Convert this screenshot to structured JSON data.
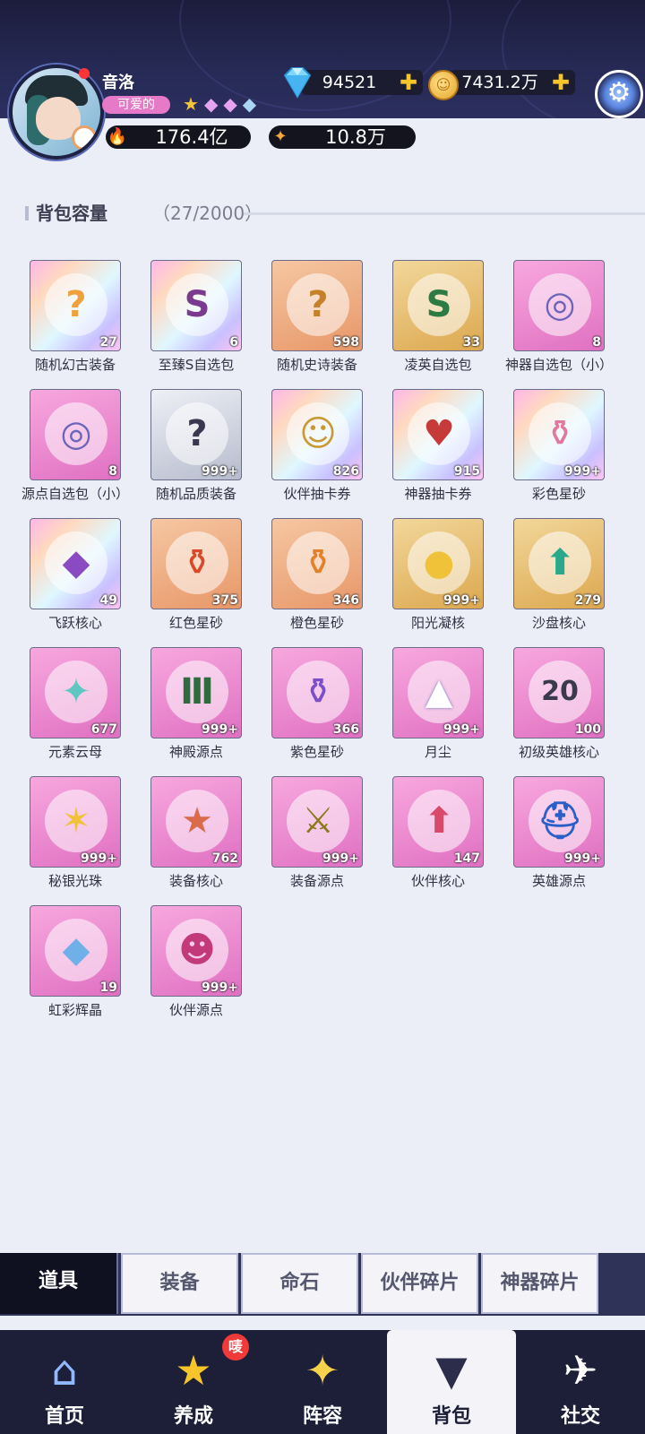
{
  "player": {
    "name": "音洛",
    "title_badge": "可爱的",
    "stars": [
      "★",
      "◆",
      "◆",
      "◆"
    ],
    "power": "176.4亿",
    "power_icon": "flame-icon",
    "stat2": "10.8万",
    "stat2_icon": "sparkle-icon"
  },
  "currency": {
    "diamonds": "94521",
    "gold": "7431.2万",
    "plus": "✚"
  },
  "capacity": {
    "label": "背包容量",
    "count": "（27/2000）"
  },
  "items": [
    {
      "name": "随机幻古装备",
      "qty": "27",
      "bg": "rainbow",
      "glyph": "?",
      "color": "#f0a03c",
      "icon": "chest-rainbow-icon"
    },
    {
      "name": "至臻S自选包",
      "qty": "6",
      "bg": "rainbow",
      "glyph": "S",
      "color": "#7a3b8f",
      "icon": "s-pack-icon"
    },
    {
      "name": "随机史诗装备",
      "qty": "598",
      "bg": "orange",
      "glyph": "?",
      "color": "#c5812a",
      "icon": "chest-epic-icon"
    },
    {
      "name": "凌英自选包",
      "qty": "33",
      "bg": "gold",
      "glyph": "S",
      "color": "#2d7a45",
      "icon": "s-pack-green-icon"
    },
    {
      "name": "神器自选包（小）",
      "qty": "8",
      "bg": "pink",
      "glyph": "◎",
      "color": "#6b64b8",
      "icon": "artifact-chest-icon"
    },
    {
      "name": "源点自选包（小）",
      "qty": "8",
      "bg": "pink",
      "glyph": "◎",
      "color": "#6b64b8",
      "icon": "source-chest-icon"
    },
    {
      "name": "随机品质装备",
      "qty": "999+",
      "bg": "silver",
      "glyph": "?",
      "color": "#3a3850",
      "icon": "mystery-chest-icon"
    },
    {
      "name": "伙伴抽卡券",
      "qty": "826",
      "bg": "rainbow",
      "glyph": "☺",
      "color": "#c99a33",
      "icon": "partner-card-icon"
    },
    {
      "name": "神器抽卡券",
      "qty": "915",
      "bg": "rainbow",
      "glyph": "♥",
      "color": "#c73a3a",
      "icon": "artifact-card-icon"
    },
    {
      "name": "彩色星砂",
      "qty": "999+",
      "bg": "rainbow",
      "glyph": "⚱",
      "color": "#e2779f",
      "icon": "colored-sand-icon"
    },
    {
      "name": "飞跃核心",
      "qty": "49",
      "bg": "rainbow",
      "glyph": "◆",
      "color": "#8a4bc2",
      "icon": "leap-core-icon"
    },
    {
      "name": "红色星砂",
      "qty": "375",
      "bg": "orange",
      "glyph": "⚱",
      "color": "#d8492a",
      "icon": "red-sand-icon"
    },
    {
      "name": "橙色星砂",
      "qty": "346",
      "bg": "orange",
      "glyph": "⚱",
      "color": "#e2812a",
      "icon": "orange-sand-icon"
    },
    {
      "name": "阳光凝核",
      "qty": "999+",
      "bg": "gold",
      "glyph": "●",
      "color": "#f0c23a",
      "icon": "sunlight-core-icon"
    },
    {
      "name": "沙盘核心",
      "qty": "279",
      "bg": "gold",
      "glyph": "⬆",
      "color": "#2aa88a",
      "icon": "sandbox-core-icon"
    },
    {
      "name": "元素云母",
      "qty": "677",
      "bg": "pink",
      "glyph": "✦",
      "color": "#5fc7c1",
      "icon": "element-mica-icon"
    },
    {
      "name": "神殿源点",
      "qty": "999+",
      "bg": "pink",
      "glyph": "Ⅲ",
      "color": "#2e6c3e",
      "icon": "temple-source-icon"
    },
    {
      "name": "紫色星砂",
      "qty": "366",
      "bg": "pink",
      "glyph": "⚱",
      "color": "#7a4fc7",
      "icon": "purple-sand-icon"
    },
    {
      "name": "月尘",
      "qty": "999+",
      "bg": "pink",
      "glyph": "▲",
      "color": "#ffffff",
      "icon": "moon-dust-icon"
    },
    {
      "name": "初级英雄核心",
      "qty": "100",
      "bg": "pink",
      "glyph": "20",
      "color": "#3a3a4e",
      "icon": "hero-core-icon"
    },
    {
      "name": "秘银光珠",
      "qty": "999+",
      "bg": "pink",
      "glyph": "✶",
      "color": "#f0c23a",
      "icon": "mithril-orb-icon"
    },
    {
      "name": "装备核心",
      "qty": "762",
      "bg": "pink",
      "glyph": "★",
      "color": "#d96b4a",
      "icon": "equip-core-icon"
    },
    {
      "name": "装备源点",
      "qty": "999+",
      "bg": "pink",
      "glyph": "⚔",
      "color": "#8a7a1a",
      "icon": "equip-source-icon"
    },
    {
      "name": "伙伴核心",
      "qty": "147",
      "bg": "pink",
      "glyph": "⬆",
      "color": "#d94a6a",
      "icon": "partner-core-icon"
    },
    {
      "name": "英雄源点",
      "qty": "999+",
      "bg": "pink",
      "glyph": "⛑",
      "color": "#2a5fc7",
      "icon": "hero-source-icon"
    },
    {
      "name": "虹彩辉晶",
      "qty": "19",
      "bg": "pink",
      "glyph": "◆",
      "color": "#6fb0e8",
      "icon": "iridescent-crystal-icon"
    },
    {
      "name": "伙伴源点",
      "qty": "999+",
      "bg": "pink",
      "glyph": "☻",
      "color": "#c23a7a",
      "icon": "partner-source-icon"
    }
  ],
  "tabs": [
    "道具",
    "装备",
    "命石",
    "伙伴碎片",
    "神器碎片"
  ],
  "active_tab": "道具",
  "nav": [
    {
      "label": "首页",
      "icon": "home-icon",
      "glyph": "⌂"
    },
    {
      "label": "养成",
      "icon": "star-growth-icon",
      "glyph": "★"
    },
    {
      "label": "阵容",
      "icon": "formation-icon",
      "glyph": "✦"
    },
    {
      "label": "背包",
      "icon": "backpack-icon",
      "glyph": "▼"
    },
    {
      "label": "社交",
      "icon": "social-icon",
      "glyph": "✈"
    }
  ],
  "nav_badge": "唛",
  "active_nav": "背包"
}
